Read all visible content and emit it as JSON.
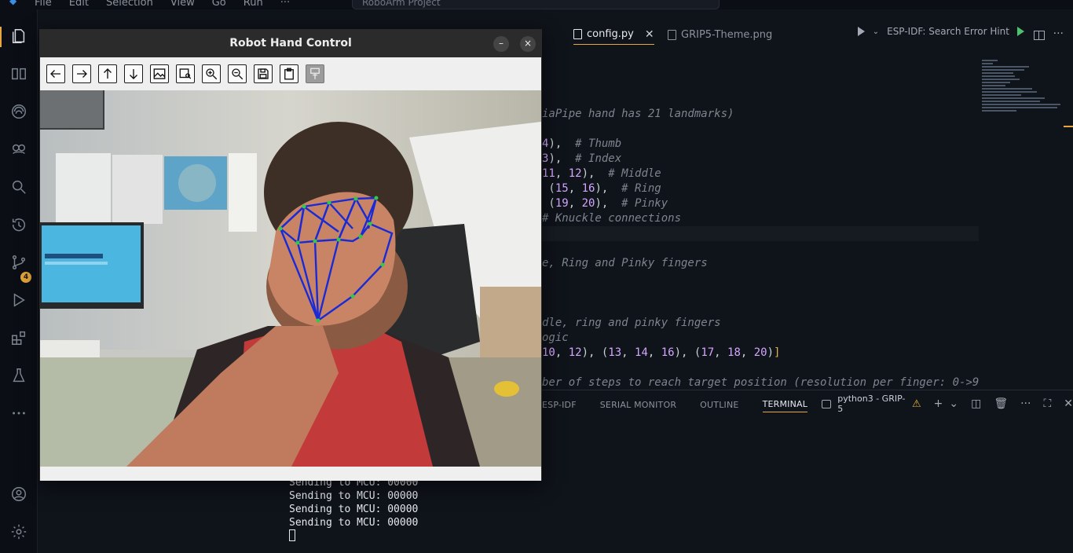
{
  "menu": {
    "items": [
      "File",
      "Edit",
      "Selection",
      "View",
      "Go",
      "Run",
      "···"
    ]
  },
  "command_center": {
    "text": "RoboArm Project"
  },
  "tabs": [
    {
      "label": "config.py",
      "active": true
    },
    {
      "label": "GRIP5-Theme.png",
      "active": false
    }
  ],
  "run_area": {
    "label": "ESP-IDF: Search Error Hint"
  },
  "code_lines": [
    {
      "code": "",
      "comment": "iaPipe hand has 21 landmarks)"
    },
    {
      "code": "",
      "comment": ""
    },
    {
      "code": "4),  ",
      "comment": "# Thumb"
    },
    {
      "code": "3),  ",
      "comment": "# Index"
    },
    {
      "code": "11, 12),  ",
      "comment": "# Middle"
    },
    {
      "code": " (15, 16),  ",
      "comment": "# Ring"
    },
    {
      "code": " (19, 20),  ",
      "comment": "# Pinky"
    },
    {
      "code": "",
      "comment": "# Knuckle connections"
    },
    {
      "code": "",
      "comment": ""
    },
    {
      "code": "",
      "comment": ""
    },
    {
      "code": "",
      "comment": "e, Ring and Pinky fingers"
    },
    {
      "code": "",
      "comment": ""
    },
    {
      "code": "",
      "comment": ""
    },
    {
      "code": "",
      "comment": ""
    },
    {
      "code": "",
      "comment": "dle, ring and pinky fingers"
    },
    {
      "code": "",
      "comment": "ogic"
    },
    {
      "code": "10, 12), (13, 14, 16), (17, 18, 20)]",
      "comment": ""
    },
    {
      "code": "",
      "comment": ""
    },
    {
      "code": "",
      "comment": "ber of steps to reach target position (resolution per finger: 0->9"
    }
  ],
  "panel": {
    "tabs": [
      "ESP-IDF",
      "SERIAL MONITOR",
      "OUTLINE",
      "TERMINAL"
    ],
    "active_tab": "TERMINAL",
    "terminal_name": "python3 - GRIP-5"
  },
  "terminal": {
    "lines": [
      "Sending to MCU: 00000",
      "Sending to MCU: 00000",
      "Sending to MCU: 00000",
      "Sending to MCU: 00000"
    ]
  },
  "window": {
    "title": "Robot Hand Control",
    "minimize": "–",
    "close": "×"
  },
  "toolbar_icons": [
    "arrow-left-icon",
    "arrow-right-icon",
    "arrow-up-icon",
    "arrow-down-icon",
    "image-icon",
    "image-search-icon",
    "zoom-in-icon",
    "zoom-out-icon",
    "save-icon",
    "clipboard-icon",
    "properties-icon"
  ],
  "activity_badge": "4",
  "colors": {
    "accent": "#e7a640",
    "badge": "#e2a33a",
    "landmark_line": "#1a2bd6",
    "landmark_point": "#2ecc40"
  }
}
